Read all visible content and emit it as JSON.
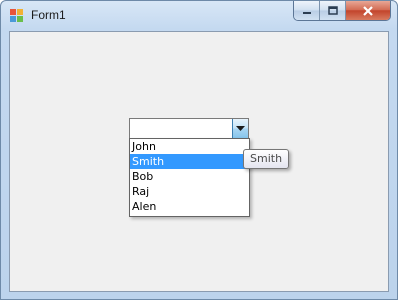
{
  "window": {
    "title": "Form1",
    "controls": [
      "minimize",
      "maximize",
      "close"
    ]
  },
  "combobox": {
    "value": "",
    "items": [
      "John",
      "Smith",
      "Bob",
      "Raj",
      "Alen"
    ],
    "highlighted": "Smith"
  },
  "tooltip": {
    "text": "Smith"
  },
  "colors": {
    "selection": "#3399ff",
    "client_bg": "#f0f0f0",
    "close_button": "#c2432a"
  },
  "icons": [
    "app-icon",
    "minimize-icon",
    "maximize-icon",
    "close-icon",
    "chevron-down-icon"
  ]
}
